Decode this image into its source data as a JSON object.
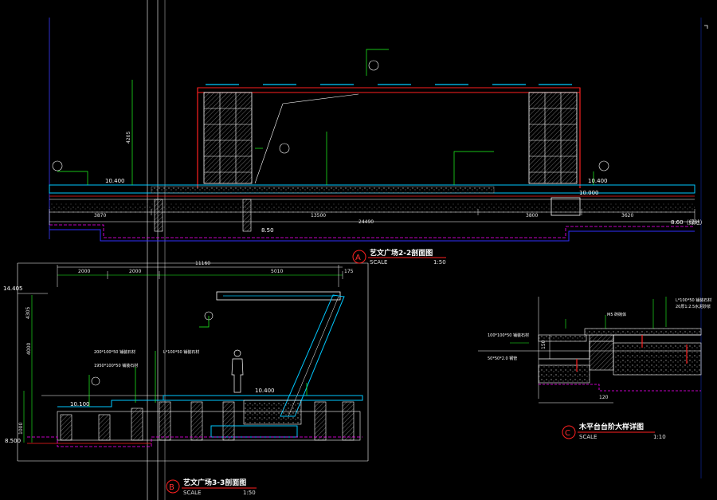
{
  "sections": {
    "a": {
      "marker": "A",
      "title": "艺文广场2-2剖面图",
      "scale_word": "SCALE",
      "scale_value": "1:50",
      "dims": [
        "3870",
        "13500",
        "3800",
        "3620",
        "24490"
      ],
      "levels": [
        "10.400",
        "10.400",
        "10.000",
        "8.50",
        "8.60（绿地）"
      ],
      "height": "4205"
    },
    "b": {
      "marker": "B",
      "title": "艺文广场3-3剖面图",
      "scale_word": "SCALE",
      "scale_value": "1:50",
      "dims_top": [
        "11160",
        "2000",
        "2000",
        "5010",
        "175"
      ],
      "levels": [
        "14.405",
        "10.100",
        "10.400",
        "8.500"
      ],
      "heights": [
        "4305",
        "4000",
        "1000"
      ],
      "notes": [
        "200*100*50 铺装石材",
        "L*100*50 铺装石材",
        "1950*100*50 铺装石材"
      ]
    },
    "c": {
      "marker": "C",
      "title": "木平台台阶大样详图",
      "scale_word": "SCALE",
      "scale_value": "1:10",
      "dims": [
        "120",
        "150"
      ],
      "notes": [
        "100*100*50 铺装石材",
        "50*50*2.0 钢管",
        "L*100*50 铺装石材",
        "20厚1:2.5水泥砂浆",
        "M5 砖砌体"
      ]
    }
  },
  "colors": {
    "background": "#000000",
    "structure": "#ff2020",
    "leader": "#20ff20",
    "dimension": "#ffffff",
    "hatch": "#9a9a9a",
    "water": "#00c8ff",
    "dashed": "#ff00ff",
    "ground": "#3030ff",
    "grid": "#0a1a6a"
  }
}
